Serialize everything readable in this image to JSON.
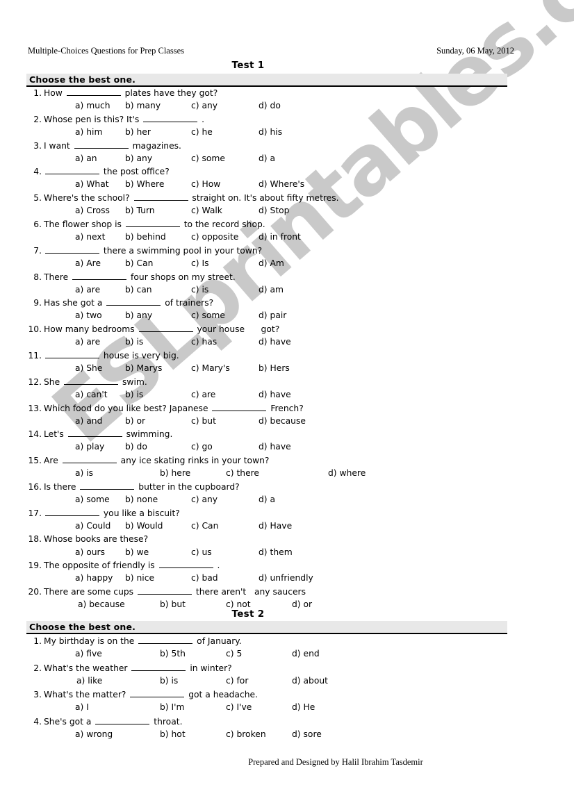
{
  "document": {
    "title": "Multiple-Choices Questions for Prep Classes",
    "date": "Sunday, 06 May, 2012",
    "footer": "Prepared and Designed by Halil Ibrahim Tasdemir",
    "watermark": "ESLprintables.com",
    "watermark_color": "#c9c9c9",
    "band_color": "#e8e8e8"
  },
  "tests": [
    {
      "heading": "Test 1",
      "instruction": "Choose the best one.",
      "questions": [
        {
          "num": "1.",
          "pre": "How",
          "post": "plates have they got?",
          "options": [
            "a) much",
            "b) many",
            "c) any",
            "d) do"
          ],
          "cols": [
            68,
            140,
            235,
            332
          ]
        },
        {
          "num": "2.",
          "pre": "Whose pen is this? It's",
          "post": ".",
          "options": [
            "a) him",
            "b) her",
            "c) he",
            "d) his"
          ],
          "cols": [
            68,
            140,
            235,
            332
          ]
        },
        {
          "num": "3.",
          "pre": "I want",
          "post": "magazines.",
          "options": [
            "a) an",
            "b) any",
            "c) some",
            "d) a"
          ],
          "cols": [
            68,
            140,
            235,
            332
          ]
        },
        {
          "num": "4.",
          "pre": "",
          "post": "the post office?",
          "options": [
            "a) What",
            "b) Where",
            "c) How",
            "d) Where's"
          ],
          "cols": [
            68,
            140,
            235,
            332
          ]
        },
        {
          "num": "5.",
          "pre": "Where's the school?",
          "post": "straight on. It's about fifty metres.",
          "options": [
            "a) Cross",
            "b) Turn",
            "c) Walk",
            "d) Stop"
          ],
          "cols": [
            68,
            140,
            235,
            332
          ]
        },
        {
          "num": "6.",
          "pre": "The flower shop is",
          "post": "to the record shop.",
          "options": [
            "a) next",
            "b) behind",
            "c) opposite",
            "d) in front"
          ],
          "cols": [
            68,
            140,
            235,
            332
          ]
        },
        {
          "num": "7.",
          "pre": "",
          "post": "there a swimming pool in your town?",
          "options": [
            "a) Are",
            "b) Can",
            "c) Is",
            "d) Am"
          ],
          "cols": [
            68,
            140,
            235,
            332
          ]
        },
        {
          "num": "8.",
          "pre": "There",
          "post": "four shops on my street.",
          "options": [
            "a) are",
            "b) can",
            "c) is",
            "d) am"
          ],
          "cols": [
            68,
            140,
            235,
            332
          ]
        },
        {
          "num": "9.",
          "pre": "Has she got a",
          "post": "of trainers?",
          "options": [
            "a) two",
            "b) any",
            "c) some",
            "d) pair"
          ],
          "cols": [
            68,
            140,
            235,
            332
          ]
        },
        {
          "num": "10.",
          "pre": "How many bedrooms",
          "post": "your house      got?",
          "options": [
            "a) are",
            "b) is",
            "c) has",
            "d) have"
          ],
          "cols": [
            68,
            140,
            235,
            332
          ]
        },
        {
          "num": "11.",
          "pre": "",
          "post": "house is very big.",
          "options": [
            "a) She",
            "b) Marys",
            "c) Mary's",
            "b) Hers"
          ],
          "cols": [
            68,
            140,
            235,
            332
          ]
        },
        {
          "num": "12.",
          "pre": "She",
          "post": "swim.",
          "options": [
            "a) can't",
            "b) is",
            "c) are",
            "d) have"
          ],
          "cols": [
            68,
            140,
            235,
            332
          ]
        },
        {
          "num": "13.",
          "pre": "Which food do you like best? Japanese",
          "post": "French?",
          "options": [
            "a) and",
            "b) or",
            "c) but",
            "d) because"
          ],
          "cols": [
            68,
            140,
            235,
            332
          ]
        },
        {
          "num": "14.",
          "pre": "Let's",
          "post": "swimming.",
          "options": [
            "a) play",
            "b) do",
            "c) go",
            "d) have"
          ],
          "cols": [
            68,
            140,
            235,
            332
          ]
        },
        {
          "num": "15.",
          "pre": "Are",
          "post": "any ice skating rinks in your town?",
          "options": [
            "a) is",
            "b) here",
            "c) there",
            "d) where"
          ],
          "cols": [
            68,
            190,
            285,
            432
          ]
        },
        {
          "num": "16.",
          "pre": "Is there",
          "post": "butter in the cupboard?",
          "options": [
            "a) some",
            "b) none",
            "c) any",
            "d) a"
          ],
          "cols": [
            68,
            140,
            235,
            332
          ]
        },
        {
          "num": "17.",
          "pre": "",
          "post": "you like a biscuit?",
          "options": [
            "a) Could",
            "b) Would",
            "c) Can",
            "d) Have"
          ],
          "cols": [
            68,
            140,
            235,
            332
          ]
        },
        {
          "num": "18.",
          "pre": "Whose books are these?",
          "post": "",
          "options": [
            "a) ours",
            "b) we",
            "c) us",
            "d) them"
          ],
          "cols": [
            68,
            140,
            235,
            332
          ]
        },
        {
          "num": "19.",
          "pre": "The opposite of friendly is",
          "post": ".",
          "options": [
            "a) happy",
            "b) nice",
            "c) bad",
            "d) unfriendly"
          ],
          "cols": [
            68,
            140,
            235,
            332
          ]
        },
        {
          "num": "20.",
          "pre": "There are some cups",
          "post": "there aren't   any saucers",
          "options": [
            "a) because",
            "b) but",
            "c) not",
            "d) or"
          ],
          "cols": [
            72,
            190,
            285,
            380
          ]
        }
      ]
    },
    {
      "heading": "Test 2",
      "instruction": "Choose the best one.",
      "questions": [
        {
          "num": "1.",
          "pre": "My birthday is on the",
          "post": "of January.",
          "options": [
            "a) five",
            "b) 5th",
            "c) 5",
            "d) end"
          ],
          "cols": [
            68,
            190,
            285,
            380
          ]
        },
        {
          "num": "2.",
          "pre": "What's the weather",
          "post": "in winter?",
          "options": [
            "a) like",
            "b) is",
            "c) for",
            "d) about"
          ],
          "cols": [
            70,
            190,
            285,
            380
          ]
        },
        {
          "num": "3.",
          "pre": "What's the matter?",
          "post": "got a headache.",
          "options": [
            "a) I",
            "b) I'm",
            "c) I've",
            "d) He"
          ],
          "cols": [
            68,
            190,
            285,
            380
          ]
        },
        {
          "num": "4.",
          "pre": "She's got a",
          "post": "throat.",
          "options": [
            "a) wrong",
            "b) hot",
            "c) broken",
            "d) sore"
          ],
          "cols": [
            68,
            190,
            285,
            380
          ]
        }
      ]
    }
  ]
}
